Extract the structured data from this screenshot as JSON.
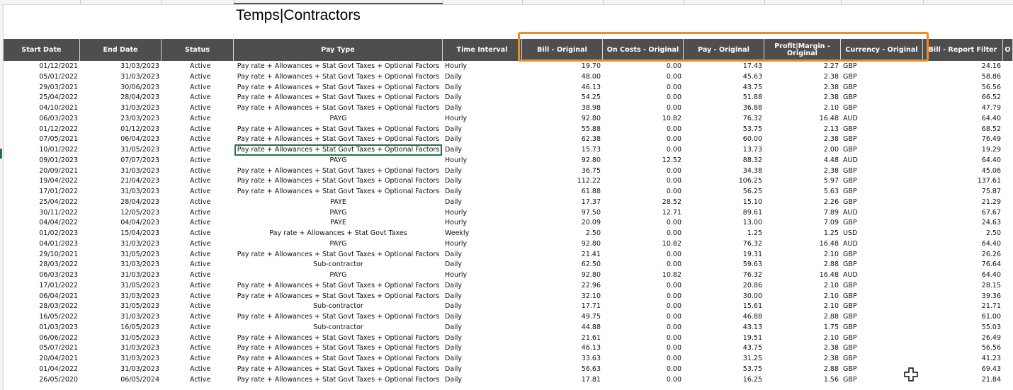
{
  "title": "Temps|Contractors",
  "columns": [
    {
      "key": "start",
      "label": "Start Date"
    },
    {
      "key": "end",
      "label": "End Date"
    },
    {
      "key": "status",
      "label": "Status"
    },
    {
      "key": "paytype",
      "label": "Pay Type"
    },
    {
      "key": "interval",
      "label": "Time Interval"
    },
    {
      "key": "bill",
      "label": "Bill - Original"
    },
    {
      "key": "oncosts",
      "label": "On Costs - Original"
    },
    {
      "key": "pay",
      "label": "Pay - Original"
    },
    {
      "key": "profit",
      "label": "Profit|Margin - Original"
    },
    {
      "key": "currency",
      "label": "Currency - Original"
    },
    {
      "key": "billrf",
      "label": "Bill - Report Filter"
    },
    {
      "key": "next",
      "label": "O"
    }
  ],
  "rows": [
    {
      "start": "01/12/2021",
      "end": "31/03/2023",
      "status": "Active",
      "paytype": "Pay rate + Allowances + Stat Govt Taxes + Optional Factors",
      "interval": "Hourly",
      "bill": "19.70",
      "oncosts": "0.00",
      "pay": "17.43",
      "profit": "2.27",
      "currency": "GBP",
      "billrf": "24.16"
    },
    {
      "start": "05/01/2022",
      "end": "31/03/2023",
      "status": "Active",
      "paytype": "Pay rate + Allowances + Stat Govt Taxes + Optional Factors",
      "interval": "Daily",
      "bill": "48.00",
      "oncosts": "0.00",
      "pay": "45.63",
      "profit": "2.38",
      "currency": "GBP",
      "billrf": "58.86"
    },
    {
      "start": "29/03/2021",
      "end": "30/06/2023",
      "status": "Active",
      "paytype": "Pay rate + Allowances + Stat Govt Taxes + Optional Factors",
      "interval": "Daily",
      "bill": "46.13",
      "oncosts": "0.00",
      "pay": "43.75",
      "profit": "2.38",
      "currency": "GBP",
      "billrf": "56.56"
    },
    {
      "start": "25/04/2022",
      "end": "28/04/2023",
      "status": "Active",
      "paytype": "Pay rate + Allowances + Stat Govt Taxes + Optional Factors",
      "interval": "Daily",
      "bill": "54.25",
      "oncosts": "0.00",
      "pay": "51.88",
      "profit": "2.38",
      "currency": "GBP",
      "billrf": "66.52"
    },
    {
      "start": "04/10/2021",
      "end": "31/03/2023",
      "status": "Active",
      "paytype": "Pay rate + Allowances + Stat Govt Taxes + Optional Factors",
      "interval": "Daily",
      "bill": "38.98",
      "oncosts": "0.00",
      "pay": "36.88",
      "profit": "2.10",
      "currency": "GBP",
      "billrf": "47.79"
    },
    {
      "start": "06/03/2023",
      "end": "23/03/2023",
      "status": "Active",
      "paytype": "PAYG",
      "interval": "Hourly",
      "bill": "92.80",
      "oncosts": "10.82",
      "pay": "76.32",
      "profit": "16.48",
      "currency": "AUD",
      "billrf": "64.40"
    },
    {
      "start": "01/12/2022",
      "end": "01/12/2023",
      "status": "Active",
      "paytype": "Pay rate + Allowances + Stat Govt Taxes + Optional Factors",
      "interval": "Daily",
      "bill": "55.88",
      "oncosts": "0.00",
      "pay": "53.75",
      "profit": "2.13",
      "currency": "GBP",
      "billrf": "68.52"
    },
    {
      "start": "07/05/2021",
      "end": "06/04/2023",
      "status": "Active",
      "paytype": "Pay rate + Allowances + Stat Govt Taxes + Optional Factors",
      "interval": "Daily",
      "bill": "62.38",
      "oncosts": "0.00",
      "pay": "60.00",
      "profit": "2.38",
      "currency": "GBP",
      "billrf": "76.49"
    },
    {
      "start": "10/01/2022",
      "end": "31/05/2023",
      "status": "Active",
      "paytype": "Pay rate + Allowances + Stat Govt Taxes + Optional Factors",
      "interval": "Daily",
      "bill": "15.73",
      "oncosts": "0.00",
      "pay": "13.73",
      "profit": "2.00",
      "currency": "GBP",
      "billrf": "19.29"
    },
    {
      "start": "09/01/2023",
      "end": "07/07/2023",
      "status": "Active",
      "paytype": "PAYG",
      "interval": "Hourly",
      "bill": "92.80",
      "oncosts": "12.52",
      "pay": "88.32",
      "profit": "4.48",
      "currency": "AUD",
      "billrf": "64.40"
    },
    {
      "start": "20/09/2021",
      "end": "31/03/2023",
      "status": "Active",
      "paytype": "Pay rate + Allowances + Stat Govt Taxes + Optional Factors",
      "interval": "Daily",
      "bill": "36.75",
      "oncosts": "0.00",
      "pay": "34.38",
      "profit": "2.38",
      "currency": "GBP",
      "billrf": "45.06"
    },
    {
      "start": "19/04/2022",
      "end": "21/04/2023",
      "status": "Active",
      "paytype": "Pay rate + Allowances + Stat Govt Taxes + Optional Factors",
      "interval": "Daily",
      "bill": "112.22",
      "oncosts": "0.00",
      "pay": "106.25",
      "profit": "5.97",
      "currency": "GBP",
      "billrf": "137.61"
    },
    {
      "start": "17/01/2022",
      "end": "31/03/2023",
      "status": "Active",
      "paytype": "Pay rate + Allowances + Stat Govt Taxes + Optional Factors",
      "interval": "Daily",
      "bill": "61.88",
      "oncosts": "0.00",
      "pay": "56.25",
      "profit": "5.63",
      "currency": "GBP",
      "billrf": "75.87"
    },
    {
      "start": "25/04/2022",
      "end": "28/04/2023",
      "status": "Active",
      "paytype": "PAYE",
      "interval": "Daily",
      "bill": "17.37",
      "oncosts": "28.52",
      "pay": "15.10",
      "profit": "2.26",
      "currency": "GBP",
      "billrf": "21.29"
    },
    {
      "start": "30/11/2022",
      "end": "12/05/2023",
      "status": "Active",
      "paytype": "PAYG",
      "interval": "Hourly",
      "bill": "97.50",
      "oncosts": "12.71",
      "pay": "89.61",
      "profit": "7.89",
      "currency": "AUD",
      "billrf": "67.67"
    },
    {
      "start": "04/04/2022",
      "end": "04/04/2023",
      "status": "Active",
      "paytype": "PAYE",
      "interval": "Hourly",
      "bill": "20.09",
      "oncosts": "0.00",
      "pay": "13.00",
      "profit": "7.09",
      "currency": "GBP",
      "billrf": "24.63"
    },
    {
      "start": "01/02/2023",
      "end": "15/04/2023",
      "status": "Active",
      "paytype": "Pay rate + Allowances + Stat Govt Taxes",
      "interval": "Weekly",
      "bill": "2.50",
      "oncosts": "0.00",
      "pay": "1.25",
      "profit": "1.25",
      "currency": "USD",
      "billrf": "2.50"
    },
    {
      "start": "04/01/2023",
      "end": "31/03/2023",
      "status": "Active",
      "paytype": "PAYG",
      "interval": "Hourly",
      "bill": "92.80",
      "oncosts": "10.82",
      "pay": "76.32",
      "profit": "16.48",
      "currency": "AUD",
      "billrf": "64.40"
    },
    {
      "start": "29/10/2021",
      "end": "31/05/2023",
      "status": "Active",
      "paytype": "Pay rate + Allowances + Stat Govt Taxes + Optional Factors",
      "interval": "Daily",
      "bill": "21.41",
      "oncosts": "0.00",
      "pay": "19.31",
      "profit": "2.10",
      "currency": "GBP",
      "billrf": "26.26"
    },
    {
      "start": "28/03/2022",
      "end": "31/03/2023",
      "status": "Active",
      "paytype": "Sub-contractor",
      "interval": "Daily",
      "bill": "62.50",
      "oncosts": "0.00",
      "pay": "59.63",
      "profit": "2.88",
      "currency": "GBP",
      "billrf": "76.64"
    },
    {
      "start": "06/03/2023",
      "end": "31/03/2023",
      "status": "Active",
      "paytype": "PAYG",
      "interval": "Hourly",
      "bill": "92.80",
      "oncosts": "10.82",
      "pay": "76.32",
      "profit": "16.48",
      "currency": "AUD",
      "billrf": "64.40"
    },
    {
      "start": "17/01/2022",
      "end": "31/05/2023",
      "status": "Active",
      "paytype": "Pay rate + Allowances + Stat Govt Taxes + Optional Factors",
      "interval": "Daily",
      "bill": "22.96",
      "oncosts": "0.00",
      "pay": "20.86",
      "profit": "2.10",
      "currency": "GBP",
      "billrf": "28.15"
    },
    {
      "start": "06/04/2021",
      "end": "31/03/2023",
      "status": "Active",
      "paytype": "Pay rate + Allowances + Stat Govt Taxes + Optional Factors",
      "interval": "Daily",
      "bill": "32.10",
      "oncosts": "0.00",
      "pay": "30.00",
      "profit": "2.10",
      "currency": "GBP",
      "billrf": "39.36"
    },
    {
      "start": "28/03/2022",
      "end": "31/05/2023",
      "status": "Active",
      "paytype": "Sub-contractor",
      "interval": "Daily",
      "bill": "17.71",
      "oncosts": "0.00",
      "pay": "15.61",
      "profit": "2.10",
      "currency": "GBP",
      "billrf": "21.71"
    },
    {
      "start": "16/05/2022",
      "end": "31/03/2023",
      "status": "Active",
      "paytype": "Pay rate + Allowances + Stat Govt Taxes + Optional Factors",
      "interval": "Daily",
      "bill": "49.75",
      "oncosts": "0.00",
      "pay": "46.88",
      "profit": "2.88",
      "currency": "GBP",
      "billrf": "61.00"
    },
    {
      "start": "01/03/2023",
      "end": "16/05/2023",
      "status": "Active",
      "paytype": "Sub-contractor",
      "interval": "Daily",
      "bill": "44.88",
      "oncosts": "0.00",
      "pay": "43.13",
      "profit": "1.75",
      "currency": "GBP",
      "billrf": "55.03"
    },
    {
      "start": "06/06/2022",
      "end": "31/05/2023",
      "status": "Active",
      "paytype": "Pay rate + Allowances + Stat Govt Taxes + Optional Factors",
      "interval": "Daily",
      "bill": "21.61",
      "oncosts": "0.00",
      "pay": "19.51",
      "profit": "2.10",
      "currency": "GBP",
      "billrf": "26.49"
    },
    {
      "start": "05/07/2021",
      "end": "31/03/2023",
      "status": "Active",
      "paytype": "Pay rate + Allowances + Stat Govt Taxes + Optional Factors",
      "interval": "Daily",
      "bill": "46.13",
      "oncosts": "0.00",
      "pay": "43.75",
      "profit": "2.38",
      "currency": "GBP",
      "billrf": "56.56"
    },
    {
      "start": "20/04/2021",
      "end": "31/03/2023",
      "status": "Active",
      "paytype": "Pay rate + Allowances + Stat Govt Taxes + Optional Factors",
      "interval": "Daily",
      "bill": "33.63",
      "oncosts": "0.00",
      "pay": "31.25",
      "profit": "2.38",
      "currency": "GBP",
      "billrf": "41.23"
    },
    {
      "start": "01/04/2022",
      "end": "31/03/2023",
      "status": "Active",
      "paytype": "Pay rate + Allowances + Stat Govt Taxes + Optional Factors",
      "interval": "Daily",
      "bill": "56.63",
      "oncosts": "0.00",
      "pay": "53.75",
      "profit": "2.88",
      "currency": "GBP",
      "billrf": "69.43"
    },
    {
      "start": "26/05/2020",
      "end": "06/05/2024",
      "status": "Active",
      "paytype": "Pay rate + Allowances + Stat Govt Taxes + Optional Factors",
      "interval": "Daily",
      "bill": "17.81",
      "oncosts": "0.00",
      "pay": "16.25",
      "profit": "1.56",
      "currency": "GBP",
      "billrf": "21.84"
    }
  ],
  "colors": {
    "header_bg": "#4e4e4e",
    "highlight": "#f08c1e",
    "selection": "#217346"
  }
}
